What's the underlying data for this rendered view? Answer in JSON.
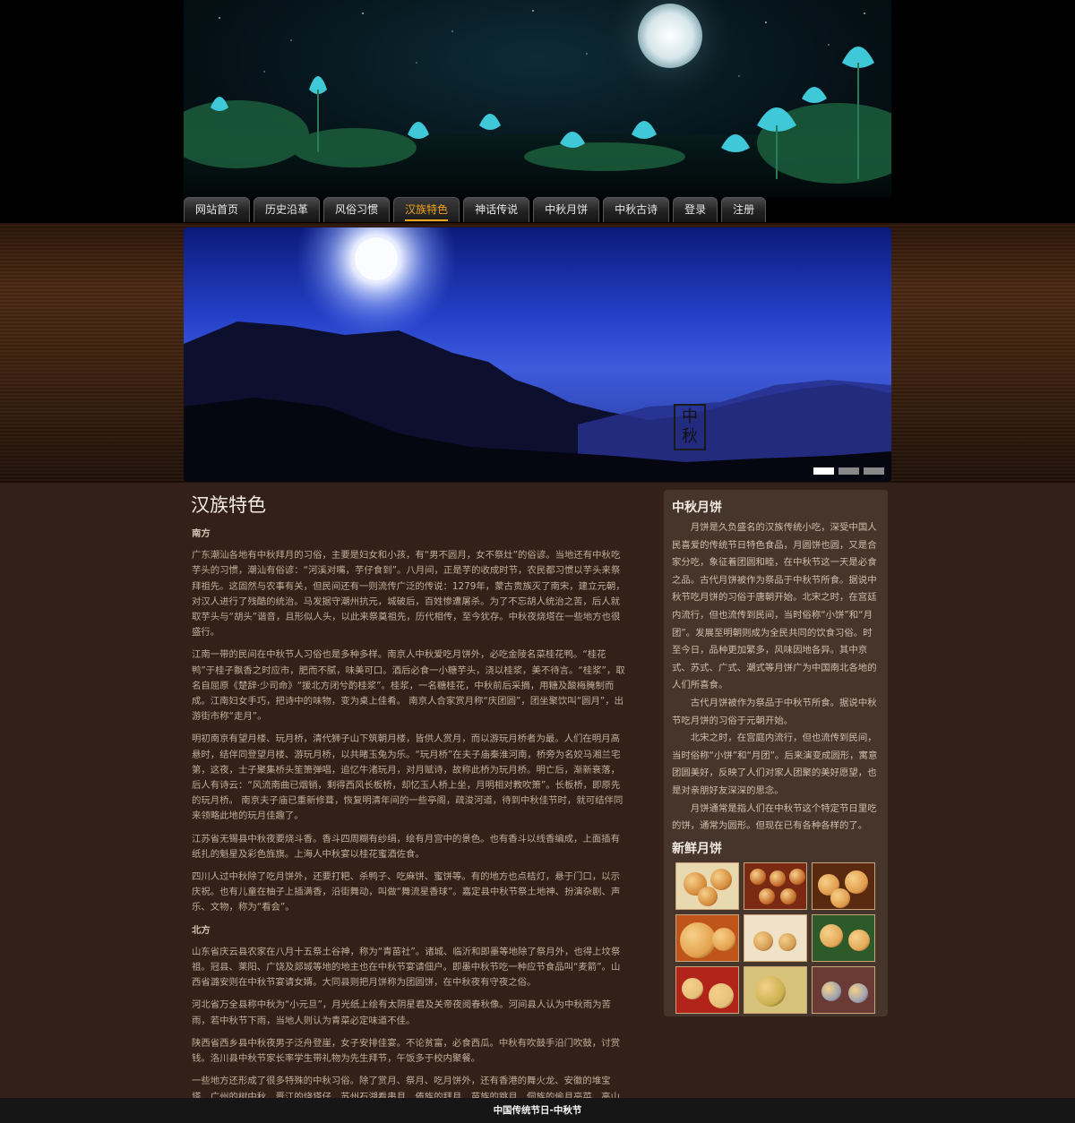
{
  "nav": [
    {
      "label": "网站首页"
    },
    {
      "label": "历史沿革"
    },
    {
      "label": "风俗习惯"
    },
    {
      "label": "汉族特色",
      "active": true
    },
    {
      "label": "神话传说"
    },
    {
      "label": "中秋月饼"
    },
    {
      "label": "中秋古诗"
    },
    {
      "label": "登录"
    },
    {
      "label": "注册"
    }
  ],
  "slider": {
    "seal_top": "中",
    "seal_bottom": "秋",
    "dots": 3,
    "active_dot": 0
  },
  "main": {
    "title": "汉族特色",
    "blocks": [
      {
        "type": "sub",
        "text": "南方"
      },
      {
        "type": "p",
        "text": "广东潮汕各地有中秋拜月的习俗，主要是妇女和小孩，有“男不圆月，女不祭灶”的俗谚。当地还有中秋吃芋头的习惯，潮汕有俗谚：“河溪对嘴，芋仔食到”。八月间，正是芋的收成时节，农民都习惯以芋头来祭拜祖先。这固然与农事有关，但民间还有一则流传广泛的传说：1279年，蒙古贵族灭了南宋，建立元朝，对汉人进行了残酷的统治。马发据守潮州抗元，城破后，百姓惨遭屠杀。为了不忘胡人统治之苦，后人就取芋头与“胡头”谐音，且形似人头，以此来祭奠祖先，历代相传，至今犹存。中秋夜烧塔在一些地方也很盛行。"
      },
      {
        "type": "p",
        "text": "江南一带的民间在中秋节人习俗也是多种多样。南京人中秋爱吃月饼外，必吃金陵名菜桂花鸭。“桂花鸭”于桂子飘香之时应市，肥而不腻，味美可口。酒后必食一小糖芋头，浇以桂浆，美不待言。“桂浆”，取名自屈原《楚辞·少司命》“援北方闭兮酌桂浆”。桂浆，一名糖桂花，中秋前后采摘，用糖及酸梅腌制而成。江南妇女手巧，把诗中的味物，变为桌上佳肴。 南京人合家赏月称“庆团圆”，团坐聚饮叫“圆月”，出游街市称“走月”。"
      },
      {
        "type": "p",
        "text": "明初南京有望月楼、玩月桥，清代狮子山下筑朝月楼，皆供人赏月，而以游玩月桥者为最。人们在明月高悬时，结伴同登望月楼、游玩月桥，以共睹玉兔为乐。“玩月桥”在夫子庙秦淮河南，桥旁为名姣马湘兰宅第，这夜，士子聚集桥头笙箫弹唱，追忆牛渚玩月，对月赋诗，故称此桥为玩月桥。明亡后，渐新衰落，后人有诗云：“风流南曲已烟销，剩得西风长板桥，却忆玉人桥上坐，月明相对教吹箫”。长板桥，即原先的玩月桥。 南京夫子庙已重新修葺，恢复明清年间的一些亭阁，疏浚河道，待到中秋佳节时，就可结伴同来领略此地的玩月佳趣了。"
      },
      {
        "type": "p",
        "text": "江苏省无锡县中秋夜要烧斗香。香斗四周糊有纱绢，绘有月宫中的景色。也有香斗以线香编成，上面插有纸扎的魁星及彩色旌旗。上海人中秋宴以桂花蜜酒佐食。"
      },
      {
        "type": "p",
        "text": "四川人过中秋除了吃月饼外，还要打粑、杀鸭子、吃麻饼、蜜饼等。有的地方也点桔灯，悬于门口，以示庆祝。也有儿童在柚子上插满香，沿街舞动，叫做“舞流星香球”。嘉定县中秋节祭土地神、扮演杂剧、声乐、文物，称为“看会”。"
      },
      {
        "type": "sub",
        "text": "北方"
      },
      {
        "type": "p",
        "text": "山东省庆云县农家在八月十五祭土谷神，称为“青苗社”。诸城、临沂和即墨等地除了祭月外，也得上坟祭祖。冠县、莱阳、广饶及郯城等地的地主也在中秋节宴请佃户。即墨中秋节吃一种应节食品叫“麦箭”。山西省潞安则在中秋节宴请女婿。大同县则把月饼称为团圆饼，在中秋夜有守夜之俗。"
      },
      {
        "type": "p",
        "text": "河北省万全县称中秋为“小元旦”，月光纸上绘有太阴星君及关帝夜阅春秋像。河间县人认为中秋雨为苦雨，若中秋节下雨，当地人则认为青菜必定味道不佳。"
      },
      {
        "type": "p",
        "text": "陕西省西乡县中秋夜男子泛舟登崖，女子安排佳宴。不论贫富，必食西瓜。中秋有吹鼓手沿门吹鼓，讨赏钱。洛川县中秋节家长率学生带礼物为先生拜节，午饭多于校内聚餐。"
      },
      {
        "type": "p",
        "text": "一些地方还形成了很多特殊的中秋习俗。除了赏月、祭月、吃月饼外，还有香港的舞火龙、安徽的堆宝塔、广州的树中秋、晋江的烧塔仔、苏州石湖看串月、傣族的拜月、苗族的跳月、侗族的偷月亮菜、高山族的托球舞等。"
      }
    ]
  },
  "sidebar": {
    "title": "中秋月饼",
    "paragraphs": [
      "月饼是久负盛名的汉族传统小吃，深受中国人民喜爱的传统节日特色食品，月圆饼也圆，又是合家分吃，象征着团圆和睦，在中秋节这一天是必食之品。古代月饼被作为祭品于中秋节所食。据说中秋节吃月饼的习俗于唐朝开始。北宋之时，在宫廷内流行，但也流传到民间，当时俗称“小饼”和“月团”。发展至明朝则成为全民共同的饮食习俗。时至今日，品种更加繁多，风味因地各异。其中京式、苏式、广式、潮式等月饼广为中国南北各地的人们所喜食。",
      "古代月饼被作为祭品于中秋节所食。据说中秋节吃月饼的习俗于元朝开始。",
      "北宋之时，在宫庭内流行，但也流传到民间，当时俗称“小饼”和“月团”。后来演变成圆形，寓意团圆美好，反映了人们对家人团聚的美好愿望，也是对亲朋好友深深的思念。",
      "月饼通常是指人们在中秋节这个特定节日里吃的饼，通常为圆形。但现在已有各种各样的了。"
    ],
    "fresh_title": "新鲜月饼",
    "thumbs": [
      {
        "bg": "#e8d9b0",
        "accent": "#d48a3a"
      },
      {
        "bg": "#7a2a12",
        "accent": "#c46a2a"
      },
      {
        "bg": "#5a2a10",
        "accent": "#e09a4a"
      },
      {
        "bg": "#c0551c",
        "accent": "#e3a04c"
      },
      {
        "bg": "#f0e2c8",
        "accent": "#d29a52"
      },
      {
        "bg": "#2e5a2a",
        "accent": "#e2a858"
      },
      {
        "bg": "#b2241a",
        "accent": "#e6c07a"
      },
      {
        "bg": "#d6c27a",
        "accent": "#c9b04e"
      },
      {
        "bg": "#6a3a34",
        "accent": "#9aa0b2"
      }
    ]
  },
  "footer": "中国传统节日-中秋节"
}
